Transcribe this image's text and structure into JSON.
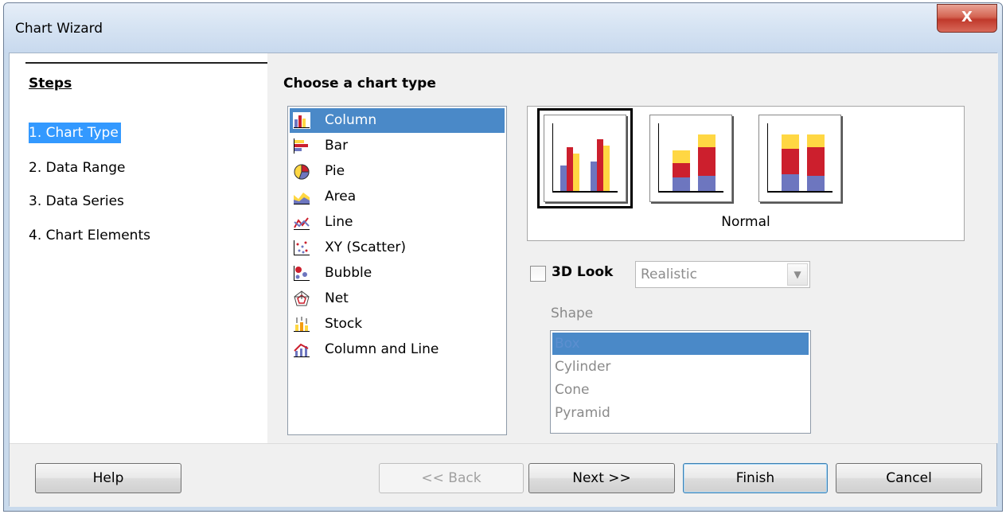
{
  "window": {
    "title": "Chart Wizard",
    "close_label": "X"
  },
  "steps": {
    "heading": "Steps",
    "items": [
      "1. Chart Type",
      "2. Data Range",
      "3. Data Series",
      "4. Chart Elements"
    ]
  },
  "main": {
    "heading": "Choose a chart type",
    "chart_types": [
      {
        "label": "Column",
        "icon": "column-chart-icon"
      },
      {
        "label": "Bar",
        "icon": "bar-chart-icon"
      },
      {
        "label": "Pie",
        "icon": "pie-chart-icon"
      },
      {
        "label": "Area",
        "icon": "area-chart-icon"
      },
      {
        "label": "Line",
        "icon": "line-chart-icon"
      },
      {
        "label": "XY (Scatter)",
        "icon": "scatter-chart-icon"
      },
      {
        "label": "Bubble",
        "icon": "bubble-chart-icon"
      },
      {
        "label": "Net",
        "icon": "net-chart-icon"
      },
      {
        "label": "Stock",
        "icon": "stock-chart-icon"
      },
      {
        "label": "Column and Line",
        "icon": "column-line-chart-icon"
      }
    ],
    "variant_caption": "Normal",
    "look_3d": {
      "label": "3D Look",
      "checked": false,
      "value": "Realistic"
    },
    "shape": {
      "label": "Shape",
      "options": [
        "Box",
        "Cylinder",
        "Cone",
        "Pyramid"
      ]
    }
  },
  "buttons": {
    "help": "Help",
    "back": "<< Back",
    "next": "Next >>",
    "finish": "Finish",
    "cancel": "Cancel"
  },
  "colors": {
    "selection": "#4a89c8",
    "series_blue": "#6d76bf",
    "series_red": "#cc1f2d",
    "series_yellow": "#ffd743"
  }
}
